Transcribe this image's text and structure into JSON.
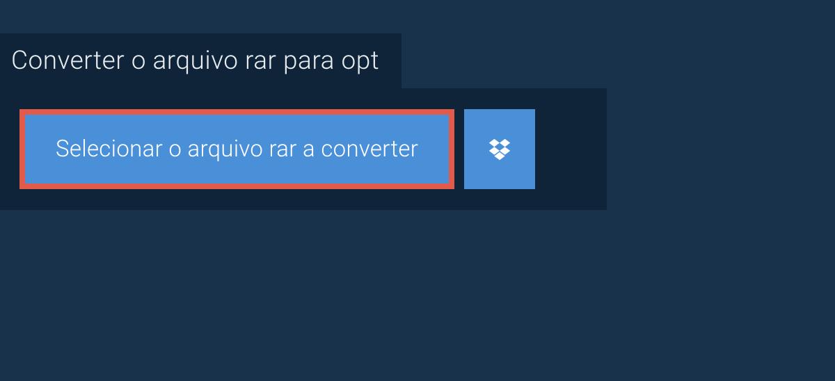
{
  "tab": {
    "title": "Converter o arquivo rar para opt"
  },
  "buttons": {
    "select_file_label": "Selecionar o arquivo rar a converter"
  }
}
